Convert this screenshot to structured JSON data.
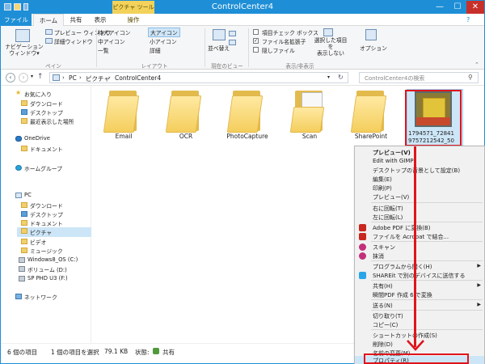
{
  "titlebar": {
    "title": "ControlCenter4",
    "context_tab": "ピクチャ ツール",
    "min": "—",
    "max": "☐",
    "close": "✕"
  },
  "tabs": {
    "file": "ファイル",
    "home": "ホーム",
    "share": "共有",
    "view": "表示",
    "manage": "操作"
  },
  "ribbon": {
    "nav_pane": "ナビゲーション\nウィンドウ▾",
    "preview_pane": "プレビュー ウィンドウ",
    "details_pane": "詳細ウィンドウ",
    "pane_group": "ペイン",
    "xl_icons": "特大アイコン",
    "l_icons": "大アイコン",
    "m_icons": "中アイコン",
    "s_icons": "小アイコン",
    "list": "一覧",
    "details": "詳細",
    "layout_group": "レイアウト",
    "sort": "並べ替え",
    "current_view_group": "現在のビュー",
    "item_check": "項目チェック ボックス",
    "file_ext": "ファイル名拡張子",
    "hidden": "隠しファイル",
    "hide_selected": "選択した項目を\n表示しない",
    "options": "オプション",
    "show_hide_group": "表示/非表示"
  },
  "address": {
    "path": [
      "PC",
      "ピクチャ",
      "ControlCenter4"
    ],
    "search_placeholder": "ControlCenter4の検索"
  },
  "nav": {
    "favorites": "お気に入り",
    "downloads": "ダウンロード",
    "desktop": "デスクトップ",
    "recent": "最近表示した場所",
    "onedrive": "OneDrive",
    "documents": "ドキュメント",
    "homegroup": "ホームグループ",
    "pc": "PC",
    "pc_downloads": "ダウンロード",
    "pc_desktop": "デスクトップ",
    "pc_documents": "ドキュメント",
    "pictures": "ピクチャ",
    "videos": "ビデオ",
    "music": "ミュージック",
    "c_drive": "Windows8_OS (C:)",
    "d_drive": "ボリューム (D:)",
    "f_drive": "SP PHD U3 (F:)",
    "network": "ネットワーク"
  },
  "folders": [
    "Email",
    "OCR",
    "PhotoCapture",
    "Scan",
    "SharePoint"
  ],
  "selected_file": {
    "name_line1": "1794571_72841",
    "name_line2": "9757212542_50"
  },
  "status": {
    "count": "6 個の項目",
    "selection": "1 個の項目を選択",
    "size": "79.1 KB",
    "state_label": "状態:",
    "state": "共有"
  },
  "menu": {
    "preview": "プレビュー(V)",
    "edit_gimp": "Edit with GIMP",
    "set_wallpaper": "デスクトップの背景として設定(B)",
    "edit": "編集(E)",
    "print": "印刷(P)",
    "preview2": "プレビュー(V)",
    "rotate_right": "右に回転(T)",
    "rotate_left": "左に回転(L)",
    "adobe_pdf": "Adobe PDF に変換(B)",
    "acrobat_combine": "ファイルを Acrobat で結合...",
    "scan": "スキャン",
    "scan_virus": "抹消",
    "open_with": "プログラムから開く(H)",
    "shareit": "SHAREit で別のデバイスに送信する",
    "share": "共有(H)",
    "pdf_convert": "瞬間PDF 作成 6 で変換",
    "send_to": "送る(N)",
    "cut": "切り取り(T)",
    "copy": "コピー(C)",
    "shortcut": "ショートカットの作成(S)",
    "delete": "削除(D)",
    "rename": "名前の変更(M)",
    "properties": "プロパティ(R)"
  },
  "colors": {
    "accent": "#1e8fd6",
    "highlight": "#e0141b",
    "context_tab": "#f3d25b"
  }
}
